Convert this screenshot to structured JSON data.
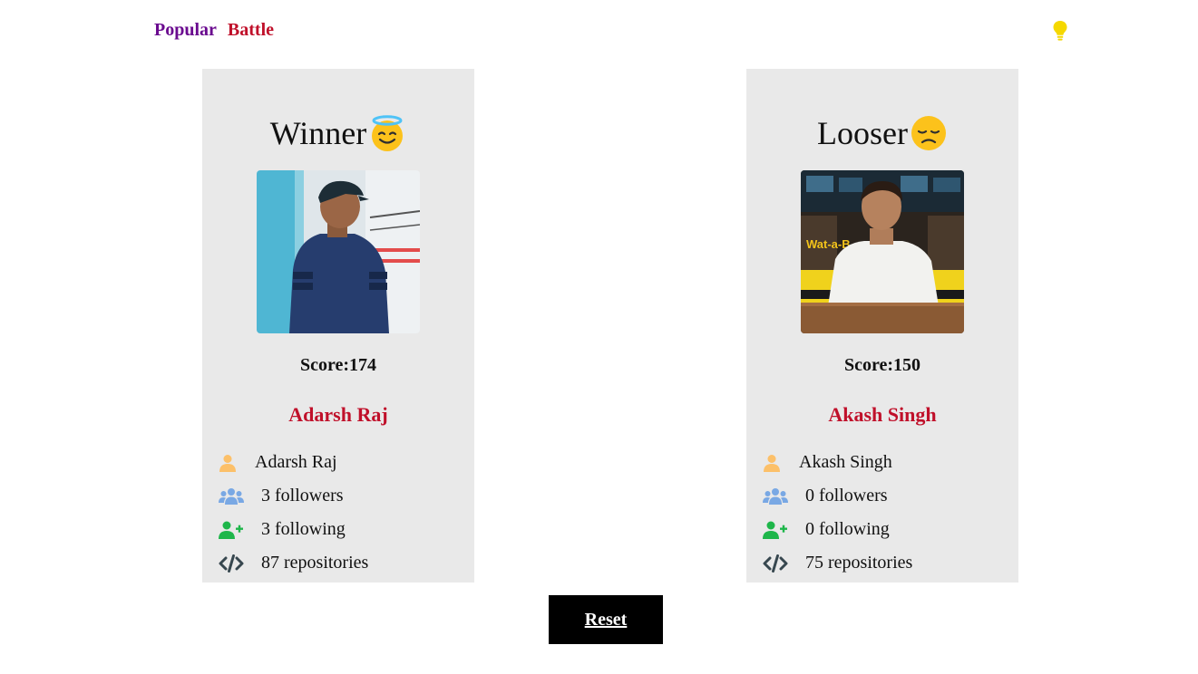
{
  "nav": {
    "popular_label": "Popular",
    "battle_label": "Battle",
    "theme_toggle_icon": "lightbulb-icon",
    "popular_color": "#6a0a8f",
    "battle_color": "#c0102a",
    "bulb_color": "#f5d800"
  },
  "players": [
    {
      "result_label": "Winner",
      "result_emoji": "smiling-face-with-halo",
      "photo": "avatar-photo",
      "score": "Score:174",
      "name": "Adarsh Raj",
      "stats": {
        "login": "Adarsh Raj",
        "followers": "3 followers",
        "following": "3 following",
        "repositories": "87 repositories"
      }
    },
    {
      "result_label": "Looser",
      "result_emoji": "disappointed-face",
      "photo": "avatar-photo",
      "score": "Score:150",
      "name": "Akash Singh",
      "stats": {
        "login": "Akash Singh",
        "followers": "0 followers",
        "following": "0 following",
        "repositories": "75 repositories"
      }
    }
  ],
  "icons": {
    "user": "user-icon",
    "followers": "users-icon",
    "following": "user-plus-icon",
    "repositories": "code-icon"
  },
  "colors": {
    "card_bg": "#e9e9e9",
    "name_link": "#c0102a",
    "user_icon": "#fcc069",
    "followers_icon": "#79a8e4",
    "following_icon": "#1eb64a",
    "code_icon": "#37474f"
  },
  "reset_label": "Reset"
}
